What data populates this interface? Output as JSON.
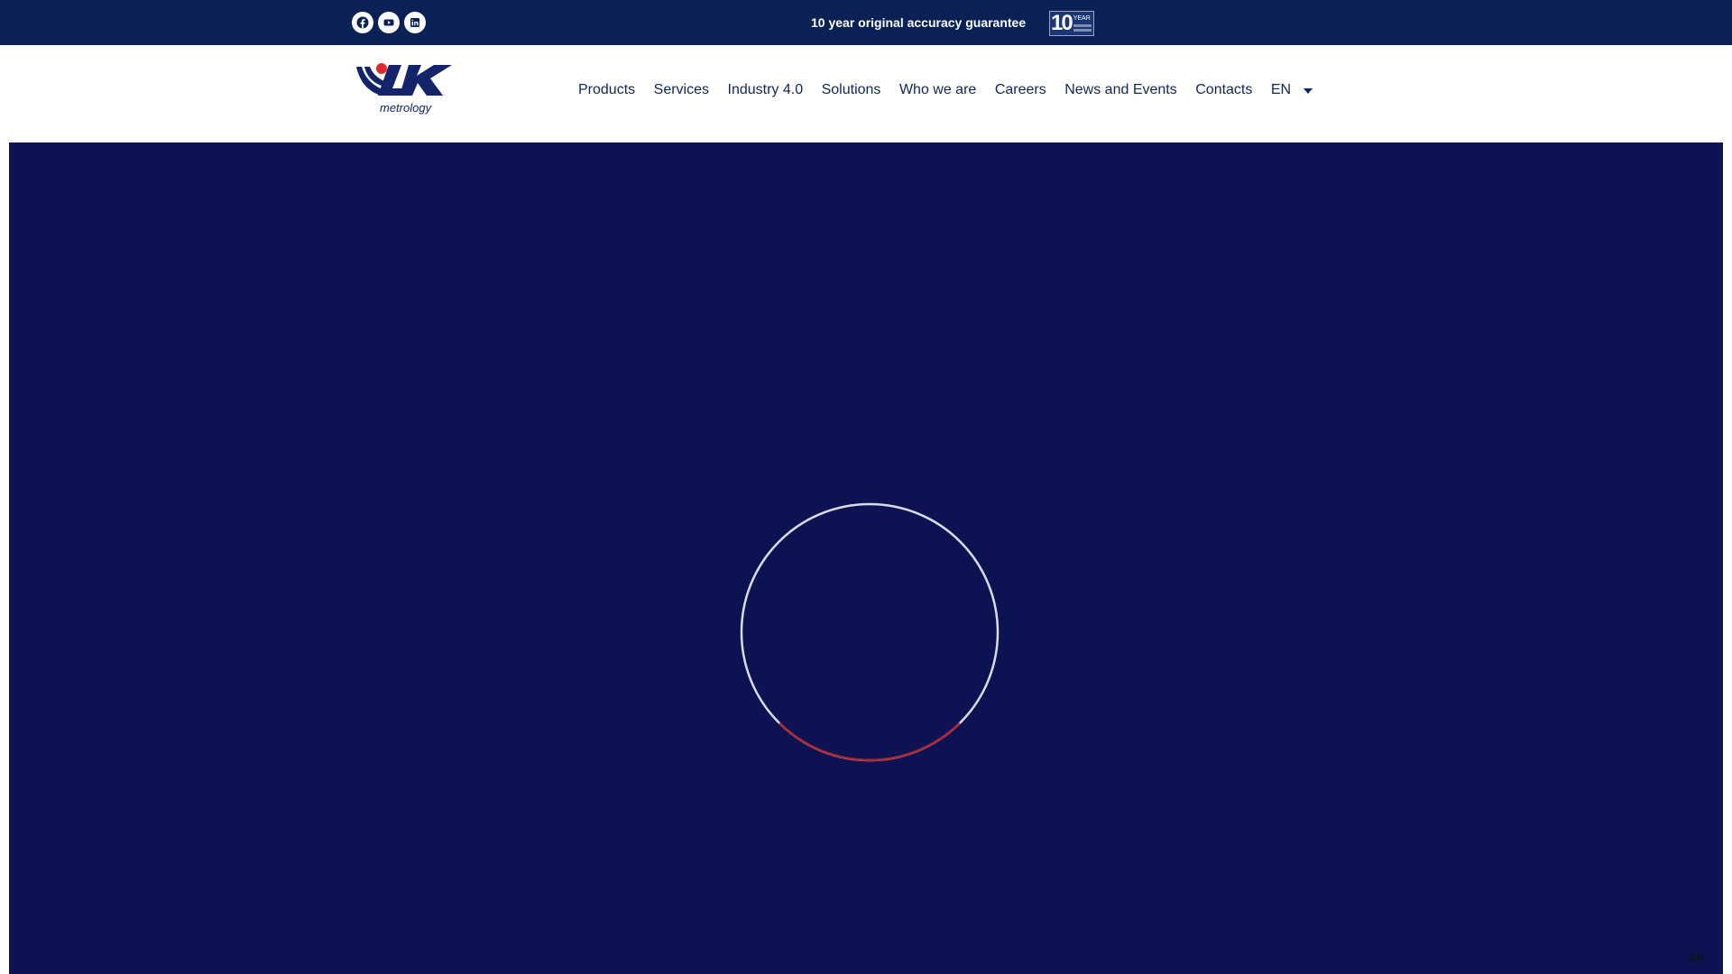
{
  "topbar": {
    "social": [
      {
        "name": "facebook-icon"
      },
      {
        "name": "youtube-icon"
      },
      {
        "name": "linkedin-icon"
      }
    ],
    "guarantee_text": "10 year original accuracy guarantee",
    "badge": {
      "number": "10",
      "label": "YEAR"
    }
  },
  "header": {
    "logo_text": "metrology",
    "nav": [
      "Products",
      "Services",
      "Industry 4.0",
      "Solutions",
      "Who we are",
      "Careers",
      "News and Events",
      "Contacts"
    ],
    "language": "EN"
  },
  "hero": {
    "loader": {
      "ring_color": "#d9dbe8",
      "accent_color": "#b3262c"
    }
  },
  "corner_language": "EN",
  "colors": {
    "topbar": "#0b2156",
    "hero": "#0d1352",
    "nav_text": "#13245a",
    "logo_red": "#e0262f"
  }
}
